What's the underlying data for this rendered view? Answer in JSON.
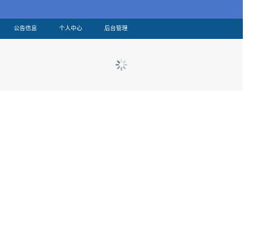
{
  "nav": {
    "items": [
      {
        "label": "公告信息"
      },
      {
        "label": "个人中心"
      },
      {
        "label": "后台管理"
      }
    ]
  },
  "loading": {
    "icon": "loading-spinner-icon"
  },
  "colors": {
    "top_banner": "#4a76c9",
    "nav_bar": "#0b568c",
    "content_bg": "#f7f7f7",
    "spinner": "#546e7a"
  }
}
